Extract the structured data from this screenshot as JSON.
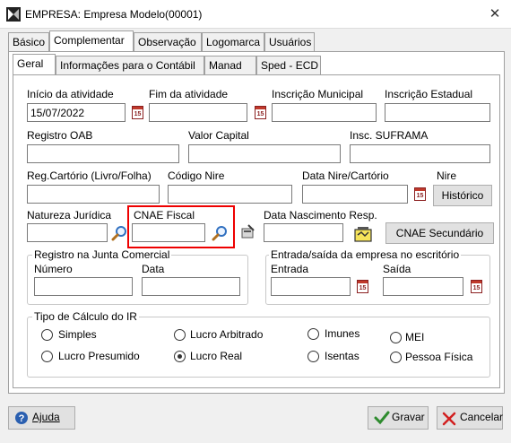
{
  "window": {
    "title": "EMPRESA: Empresa Modelo(00001)",
    "close_glyph": "✕"
  },
  "main_tabs": [
    {
      "label": "Básico"
    },
    {
      "label": "Complementar"
    },
    {
      "label": "Observação"
    },
    {
      "label": "Logomarca"
    },
    {
      "label": "Usuários"
    }
  ],
  "sub_tabs": [
    {
      "label": "Geral"
    },
    {
      "label": "Informações para o Contábil"
    },
    {
      "label": "Manad"
    },
    {
      "label": "Sped - ECD"
    }
  ],
  "fields": {
    "inicio_atividade": {
      "label": "Início da atividade",
      "value": "15/07/2022"
    },
    "fim_atividade": {
      "label": "Fim da atividade",
      "value": ""
    },
    "inscricao_municipal": {
      "label": "Inscrição Municipal",
      "value": ""
    },
    "inscricao_estadual": {
      "label": "Inscrição Estadual",
      "value": ""
    },
    "registro_oab": {
      "label": "Registro OAB",
      "value": ""
    },
    "valor_capital": {
      "label": "Valor Capital",
      "value": ""
    },
    "insc_suframa": {
      "label": "Insc. SUFRAMA",
      "value": ""
    },
    "reg_cartorio": {
      "label": "Reg.Cartório (Livro/Folha)",
      "value": ""
    },
    "codigo_nire": {
      "label": "Código Nire",
      "value": ""
    },
    "data_nire": {
      "label": "Data Nire/Cartório",
      "value": ""
    },
    "nire": {
      "label": "Nire"
    },
    "natureza_juridica": {
      "label": "Natureza Jurídica",
      "value": ""
    },
    "cnae_fiscal": {
      "label": "CNAE Fiscal",
      "value": ""
    },
    "data_nascimento_resp": {
      "label": "Data Nascimento Resp.",
      "value": ""
    }
  },
  "buttons": {
    "historico": "Histórico",
    "cnae_secundario": "CNAE Secundário",
    "ajuda": "Ajuda",
    "gravar": "Gravar",
    "cancelar": "Cancelar"
  },
  "calendar_icon_text": "15",
  "registro_junta": {
    "title": "Registro na Junta Comercial",
    "numero_label": "Número",
    "data_label": "Data"
  },
  "entrada_saida": {
    "title": "Entrada/saída da empresa no escritório",
    "entrada_label": "Entrada",
    "saida_label": "Saída"
  },
  "tipo_calculo": {
    "title": "Tipo de Cálculo do IR",
    "options": [
      {
        "label": "Simples",
        "checked": false
      },
      {
        "label": "Lucro Arbitrado",
        "checked": false
      },
      {
        "label": "Imunes",
        "checked": false
      },
      {
        "label": "MEI",
        "checked": false
      },
      {
        "label": "Lucro Presumido",
        "checked": false
      },
      {
        "label": "Lucro Real",
        "checked": true
      },
      {
        "label": "Isentas",
        "checked": false
      },
      {
        "label": "Pessoa Física",
        "checked": false
      }
    ]
  },
  "colors": {
    "highlight": "#e00000",
    "gravar_check": "#2e8b2e",
    "cancelar_x": "#d22020",
    "ajuda_icon": "#2a5fb0"
  }
}
